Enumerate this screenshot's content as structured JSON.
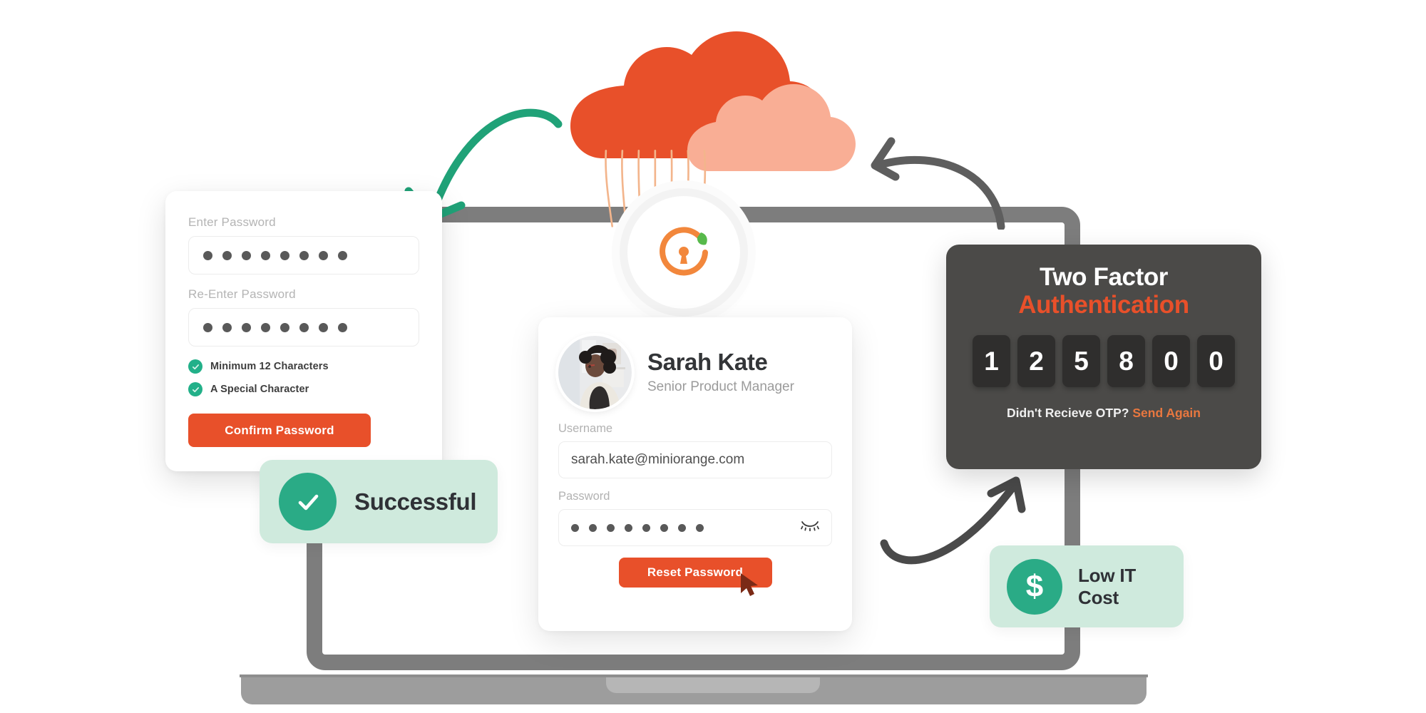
{
  "brand": {
    "orange": "#E8502A",
    "orange_light": "#F9AE95",
    "green": "#22B089",
    "green_soft": "#CFEADD",
    "dark_panel": "#4B4A48",
    "gray_frame": "#7D7D7D"
  },
  "password_card": {
    "enter_password_label": "Enter Password",
    "enter_password_value": "••••••••",
    "reenter_password_label": "Re-Enter Password",
    "reenter_password_value": "••••••••",
    "requirements": [
      {
        "label": "Minimum 12 Characters",
        "met": true
      },
      {
        "label": "A Special Character",
        "met": true
      }
    ],
    "confirm_button": "Confirm Password"
  },
  "success_badge": {
    "label": "Successful",
    "icon": "check-icon"
  },
  "profile_card": {
    "name": "Sarah Kate",
    "role": "Senior Product Manager",
    "avatar_alt": "avatar",
    "username_label": "Username",
    "username_value": "sarah.kate@miniorange.com",
    "password_label": "Password",
    "password_value": "••••••••",
    "toggle_icon": "eye-off-icon",
    "reset_button": "Reset Password",
    "cursor_icon": "cursor-arrow-icon"
  },
  "two_factor": {
    "title_line1": "Two Factor",
    "title_line2": "Authentication",
    "otp_digits": [
      "1",
      "2",
      "5",
      "8",
      "0",
      "0"
    ],
    "footer_prompt": "Didn't Recieve OTP?",
    "footer_action": "Send Again"
  },
  "cost_badge": {
    "icon_symbol": "$",
    "line1": "Low IT",
    "line2": "Cost"
  },
  "decorations": {
    "cloud_icon": "cloud-icon",
    "lock_icon": "miniorange-lock-icon",
    "green_arrow": "curved-arrow-down-left-icon",
    "dark_arrow_top": "curved-arrow-left-icon",
    "dark_arrow_bottom": "curved-arrow-up-right-icon",
    "device_icon": "laptop-icon"
  }
}
